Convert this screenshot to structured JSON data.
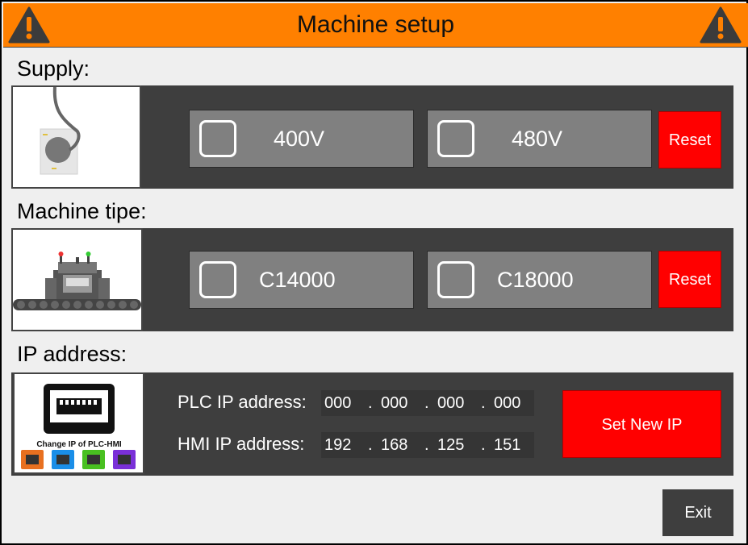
{
  "header": {
    "title": "Machine setup"
  },
  "supply": {
    "label": "Supply:",
    "options": [
      {
        "label": "400V",
        "checked": false
      },
      {
        "label": "480V",
        "checked": false
      }
    ],
    "reset_label": "Reset"
  },
  "machine": {
    "label": "Machine tipe:",
    "options": [
      {
        "label": "C14000",
        "checked": false
      },
      {
        "label": "C18000",
        "checked": false
      }
    ],
    "reset_label": "Reset"
  },
  "ip": {
    "label": "IP address:",
    "thumb_caption": "Change IP of PLC-HMI",
    "plc": {
      "label": "PLC IP address:",
      "octets": [
        "000",
        "000",
        "000",
        "000"
      ]
    },
    "hmi": {
      "label": "HMI IP address:",
      "octets": [
        "192",
        "168",
        "125",
        "151"
      ]
    },
    "separator": ".",
    "set_button": "Set New IP"
  },
  "exit_label": "Exit",
  "colors": {
    "header": "#ff8000",
    "panel": "#3e3e3e",
    "option": "#808080",
    "danger": "#ff0000"
  }
}
